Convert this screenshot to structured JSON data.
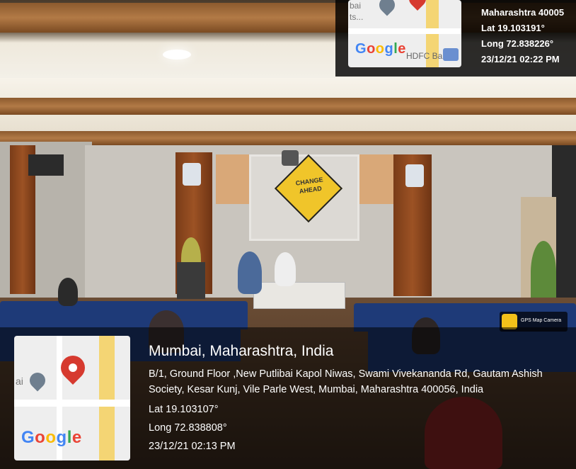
{
  "photo": {
    "description_tag": "seminar-hall-photo",
    "sign_text": [
      "CHANGE",
      "AHEAD"
    ]
  },
  "top_stamp": {
    "map_fragment_text": [
      "bai",
      "ts..."
    ],
    "bank_label": "HDFC Bank",
    "google": "Google",
    "lines": [
      "Maharashtra 40005",
      "Lat 19.103191°",
      "Long 72.838226°",
      "23/12/21 02:22 PM"
    ]
  },
  "main_stamp": {
    "map_fragment_text": "ai",
    "google": "Google",
    "app_label": "GPS Map Camera",
    "title": "Mumbai, Maharashtra, India",
    "address": "B/1, Ground Floor ,New Putlibai Kapol Niwas, Swami Vivekananda Rd, Gautam Ashish Society, Kesar Kunj, Vile Parle West, Mumbai, Maharashtra 400056, India",
    "lat": "Lat 19.103107°",
    "long": "Long 72.838808°",
    "datetime": "23/12/21 02:13 PM"
  },
  "colors": {
    "pin": "#d63a2f",
    "seat": "#1e3a78",
    "wood": "#9c5224"
  }
}
